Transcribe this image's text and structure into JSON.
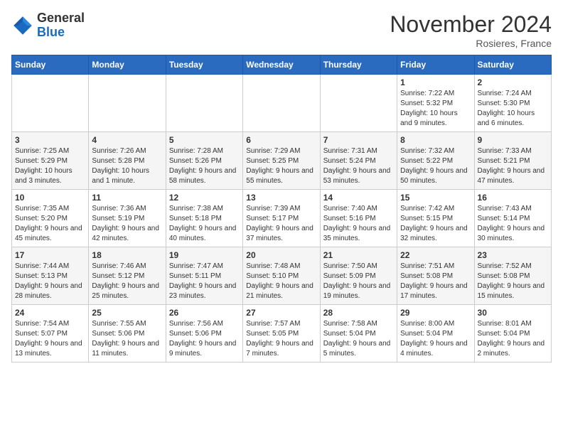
{
  "header": {
    "logo_general": "General",
    "logo_blue": "Blue",
    "month_title": "November 2024",
    "subtitle": "Rosieres, France"
  },
  "weekdays": [
    "Sunday",
    "Monday",
    "Tuesday",
    "Wednesday",
    "Thursday",
    "Friday",
    "Saturday"
  ],
  "weeks": [
    [
      {
        "day": "",
        "info": ""
      },
      {
        "day": "",
        "info": ""
      },
      {
        "day": "",
        "info": ""
      },
      {
        "day": "",
        "info": ""
      },
      {
        "day": "",
        "info": ""
      },
      {
        "day": "1",
        "info": "Sunrise: 7:22 AM\nSunset: 5:32 PM\nDaylight: 10 hours and 9 minutes."
      },
      {
        "day": "2",
        "info": "Sunrise: 7:24 AM\nSunset: 5:30 PM\nDaylight: 10 hours and 6 minutes."
      }
    ],
    [
      {
        "day": "3",
        "info": "Sunrise: 7:25 AM\nSunset: 5:29 PM\nDaylight: 10 hours and 3 minutes."
      },
      {
        "day": "4",
        "info": "Sunrise: 7:26 AM\nSunset: 5:28 PM\nDaylight: 10 hours and 1 minute."
      },
      {
        "day": "5",
        "info": "Sunrise: 7:28 AM\nSunset: 5:26 PM\nDaylight: 9 hours and 58 minutes."
      },
      {
        "day": "6",
        "info": "Sunrise: 7:29 AM\nSunset: 5:25 PM\nDaylight: 9 hours and 55 minutes."
      },
      {
        "day": "7",
        "info": "Sunrise: 7:31 AM\nSunset: 5:24 PM\nDaylight: 9 hours and 53 minutes."
      },
      {
        "day": "8",
        "info": "Sunrise: 7:32 AM\nSunset: 5:22 PM\nDaylight: 9 hours and 50 minutes."
      },
      {
        "day": "9",
        "info": "Sunrise: 7:33 AM\nSunset: 5:21 PM\nDaylight: 9 hours and 47 minutes."
      }
    ],
    [
      {
        "day": "10",
        "info": "Sunrise: 7:35 AM\nSunset: 5:20 PM\nDaylight: 9 hours and 45 minutes."
      },
      {
        "day": "11",
        "info": "Sunrise: 7:36 AM\nSunset: 5:19 PM\nDaylight: 9 hours and 42 minutes."
      },
      {
        "day": "12",
        "info": "Sunrise: 7:38 AM\nSunset: 5:18 PM\nDaylight: 9 hours and 40 minutes."
      },
      {
        "day": "13",
        "info": "Sunrise: 7:39 AM\nSunset: 5:17 PM\nDaylight: 9 hours and 37 minutes."
      },
      {
        "day": "14",
        "info": "Sunrise: 7:40 AM\nSunset: 5:16 PM\nDaylight: 9 hours and 35 minutes."
      },
      {
        "day": "15",
        "info": "Sunrise: 7:42 AM\nSunset: 5:15 PM\nDaylight: 9 hours and 32 minutes."
      },
      {
        "day": "16",
        "info": "Sunrise: 7:43 AM\nSunset: 5:14 PM\nDaylight: 9 hours and 30 minutes."
      }
    ],
    [
      {
        "day": "17",
        "info": "Sunrise: 7:44 AM\nSunset: 5:13 PM\nDaylight: 9 hours and 28 minutes."
      },
      {
        "day": "18",
        "info": "Sunrise: 7:46 AM\nSunset: 5:12 PM\nDaylight: 9 hours and 25 minutes."
      },
      {
        "day": "19",
        "info": "Sunrise: 7:47 AM\nSunset: 5:11 PM\nDaylight: 9 hours and 23 minutes."
      },
      {
        "day": "20",
        "info": "Sunrise: 7:48 AM\nSunset: 5:10 PM\nDaylight: 9 hours and 21 minutes."
      },
      {
        "day": "21",
        "info": "Sunrise: 7:50 AM\nSunset: 5:09 PM\nDaylight: 9 hours and 19 minutes."
      },
      {
        "day": "22",
        "info": "Sunrise: 7:51 AM\nSunset: 5:08 PM\nDaylight: 9 hours and 17 minutes."
      },
      {
        "day": "23",
        "info": "Sunrise: 7:52 AM\nSunset: 5:08 PM\nDaylight: 9 hours and 15 minutes."
      }
    ],
    [
      {
        "day": "24",
        "info": "Sunrise: 7:54 AM\nSunset: 5:07 PM\nDaylight: 9 hours and 13 minutes."
      },
      {
        "day": "25",
        "info": "Sunrise: 7:55 AM\nSunset: 5:06 PM\nDaylight: 9 hours and 11 minutes."
      },
      {
        "day": "26",
        "info": "Sunrise: 7:56 AM\nSunset: 5:06 PM\nDaylight: 9 hours and 9 minutes."
      },
      {
        "day": "27",
        "info": "Sunrise: 7:57 AM\nSunset: 5:05 PM\nDaylight: 9 hours and 7 minutes."
      },
      {
        "day": "28",
        "info": "Sunrise: 7:58 AM\nSunset: 5:04 PM\nDaylight: 9 hours and 5 minutes."
      },
      {
        "day": "29",
        "info": "Sunrise: 8:00 AM\nSunset: 5:04 PM\nDaylight: 9 hours and 4 minutes."
      },
      {
        "day": "30",
        "info": "Sunrise: 8:01 AM\nSunset: 5:04 PM\nDaylight: 9 hours and 2 minutes."
      }
    ]
  ]
}
